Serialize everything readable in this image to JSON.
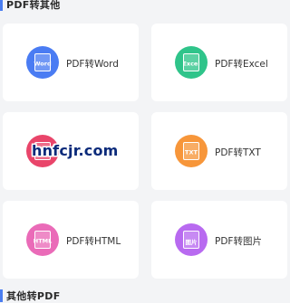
{
  "sections": {
    "top_title": "PDF转其他",
    "bottom_title": "其他转PDF"
  },
  "colors": {
    "word": "#4a7cf3",
    "excel": "#2fc48a",
    "image_to_pdf": "#e9456a",
    "txt": "#f7963a",
    "html": "#ea6bb8",
    "image": "#b86af0"
  },
  "cards": [
    {
      "label": "PDF转Word",
      "icon": "word-doc-icon",
      "badge": "Word"
    },
    {
      "label": "PDF转Excel",
      "icon": "excel-doc-icon",
      "badge": "Excel"
    },
    {
      "label": "",
      "icon": "image-doc-icon",
      "badge": ""
    },
    {
      "label": "PDF转TXT",
      "icon": "txt-doc-icon",
      "badge": "TXT"
    },
    {
      "label": "PDF转HTML",
      "icon": "html-doc-icon",
      "badge": "HTML"
    },
    {
      "label": "PDF转图片",
      "icon": "image-doc-icon",
      "badge": "图片"
    }
  ],
  "watermark": "hnfcjr.com"
}
